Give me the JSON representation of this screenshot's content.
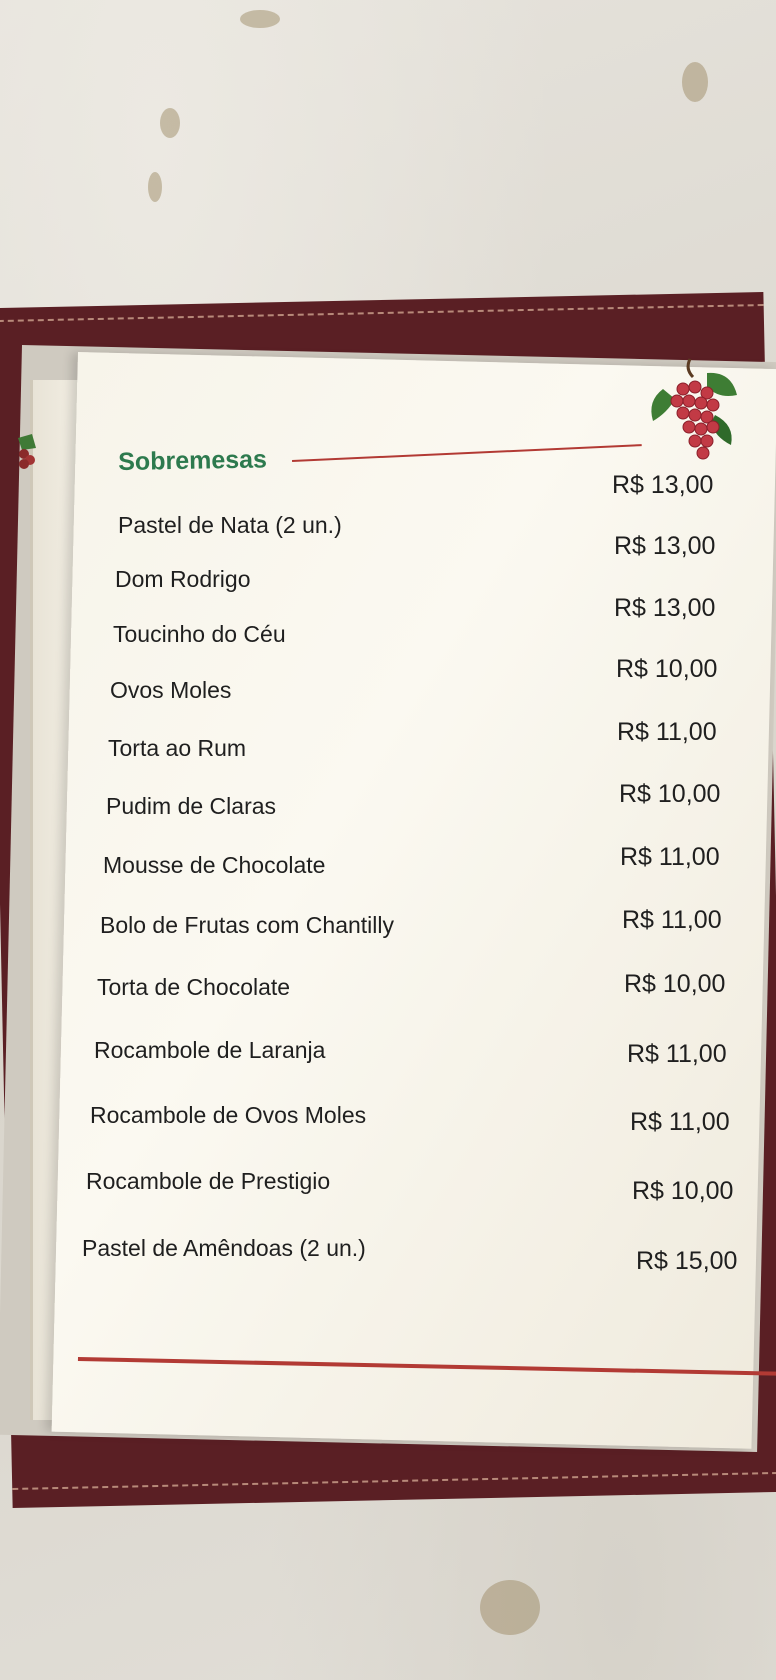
{
  "menu": {
    "title": "Sobremesas",
    "items": [
      {
        "name": "Pastel de Nata (2 un.)",
        "price": "R$ 13,00"
      },
      {
        "name": "Dom Rodrigo",
        "price": "R$ 13,00"
      },
      {
        "name": "Toucinho do Céu",
        "price": "R$ 13,00"
      },
      {
        "name": "Ovos Moles",
        "price": "R$ 10,00"
      },
      {
        "name": "Torta ao Rum",
        "price": "R$ 11,00"
      },
      {
        "name": "Pudim de Claras",
        "price": "R$ 10,00"
      },
      {
        "name": "Mousse de Chocolate",
        "price": "R$ 11,00"
      },
      {
        "name": "Bolo de Frutas com Chantilly",
        "price": "R$ 11,00"
      },
      {
        "name": "Torta de Chocolate",
        "price": "R$ 10,00"
      },
      {
        "name": "Rocambole de Laranja",
        "price": "R$ 11,00"
      },
      {
        "name": "Rocambole de Ovos  Moles",
        "price": "R$ 11,00"
      },
      {
        "name": "Rocambole de Prestigio",
        "price": "R$ 10,00"
      },
      {
        "name": "Pastel de Amêndoas (2 un.)",
        "price": "R$ 15,00"
      }
    ]
  },
  "colors": {
    "title": "#2d7a4e",
    "rule": "#b23a34",
    "folder": "#5a1f24"
  },
  "icons": {
    "decoration": "grape-cluster-icon"
  }
}
